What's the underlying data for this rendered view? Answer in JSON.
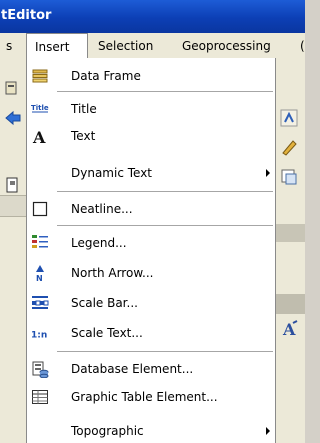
{
  "window": {
    "title": "tEditor"
  },
  "menubar": {
    "items": [
      "s",
      "Insert",
      "Selection",
      "Geoprocessing",
      "("
    ]
  },
  "insert_menu": {
    "items": [
      {
        "label": "Data Frame",
        "icon": "data-frame-icon",
        "submenu": false
      },
      {
        "label": "Title",
        "icon": "title-icon",
        "submenu": false
      },
      {
        "label": "Text",
        "icon": "text-icon",
        "submenu": false
      },
      {
        "label": "Dynamic Text",
        "icon": "",
        "submenu": true
      },
      {
        "label": "Neatline...",
        "icon": "neatline-icon",
        "submenu": false
      },
      {
        "label": "Legend...",
        "icon": "legend-icon",
        "submenu": false
      },
      {
        "label": "North Arrow...",
        "icon": "north-arrow-icon",
        "submenu": false
      },
      {
        "label": "Scale Bar...",
        "icon": "scale-bar-icon",
        "submenu": false
      },
      {
        "label": "Scale Text...",
        "icon": "scale-text-icon",
        "submenu": false
      },
      {
        "label": "Database Element...",
        "icon": "database-element-icon",
        "submenu": false
      },
      {
        "label": "Graphic Table Element...",
        "icon": "graphic-table-icon",
        "submenu": false
      },
      {
        "label": "Topographic",
        "icon": "",
        "submenu": true
      }
    ]
  },
  "icon_glyphs": {
    "title": "Title",
    "text": "A",
    "north": "N",
    "scale_text": "1:n"
  }
}
